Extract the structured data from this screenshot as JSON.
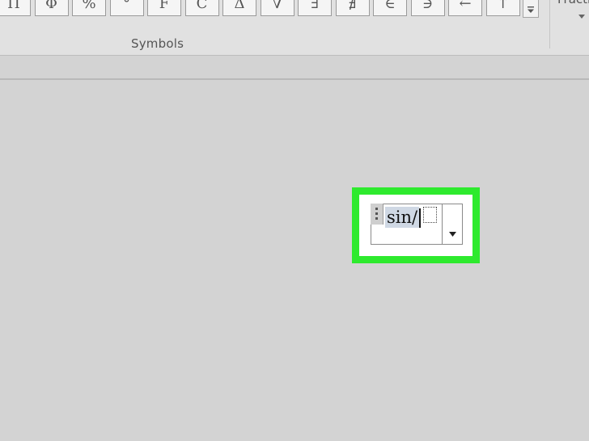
{
  "ribbon": {
    "symbols": [
      {
        "name": "Pi",
        "glyph": "Π"
      },
      {
        "name": "Phi",
        "glyph": "Φ"
      },
      {
        "name": "Percent",
        "glyph": "%"
      },
      {
        "name": "Degree",
        "glyph": "°"
      },
      {
        "name": "Fahrenheit",
        "glyph": "F"
      },
      {
        "name": "Celsius",
        "glyph": "C"
      },
      {
        "name": "Delta",
        "glyph": "Δ"
      },
      {
        "name": "Nabla",
        "glyph": "∇"
      },
      {
        "name": "Exists",
        "glyph": "∃"
      },
      {
        "name": "Not exists",
        "glyph": "∄"
      },
      {
        "name": "Element of",
        "glyph": "∈"
      },
      {
        "name": "Contains",
        "glyph": "∋"
      },
      {
        "name": "Left arrow",
        "glyph": "←"
      },
      {
        "name": "Up arrow",
        "glyph": "↑"
      }
    ],
    "group_label": "Symbols",
    "next_group_label": "Fraction"
  },
  "equation": {
    "text": "sin/",
    "highlight_color": "#2eea2e"
  }
}
